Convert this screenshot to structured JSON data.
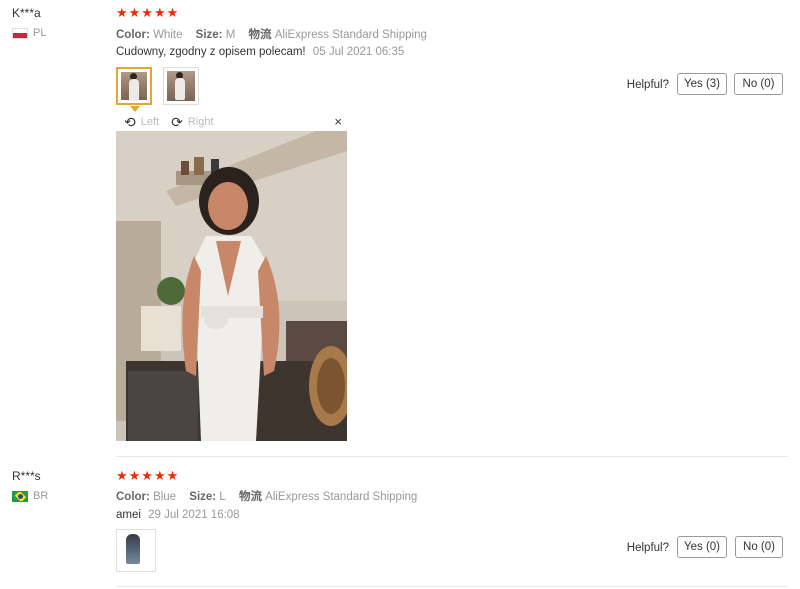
{
  "reviews": [
    {
      "user": "K***a",
      "country": "PL",
      "stars": "★★★★★",
      "color_label": "Color:",
      "color_value": "White",
      "size_label": "Size:",
      "size_value": "M",
      "logistics_label": "物流",
      "shipping": "AliExpress Standard Shipping",
      "feedback": "Cudowny, zgodny z opisem polecam!",
      "date": "05 Jul 2021 06:35",
      "helpful_label": "Helpful?",
      "yes_label": "Yes (3)",
      "no_label": "No (0)",
      "viewer": {
        "left_label": "Left",
        "right_label": "Right",
        "close_symbol": "×"
      }
    },
    {
      "user": "R***s",
      "country": "BR",
      "stars": "★★★★★",
      "color_label": "Color:",
      "color_value": "Blue",
      "size_label": "Size:",
      "size_value": "L",
      "logistics_label": "物流",
      "shipping": "AliExpress Standard Shipping",
      "feedback": "amei",
      "date": "29 Jul 2021 16:08",
      "helpful_label": "Helpful?",
      "yes_label": "Yes (0)",
      "no_label": "No (0)"
    }
  ],
  "colors": {
    "star": "#e62e04",
    "active_thumb_border": "#e5a33b"
  }
}
